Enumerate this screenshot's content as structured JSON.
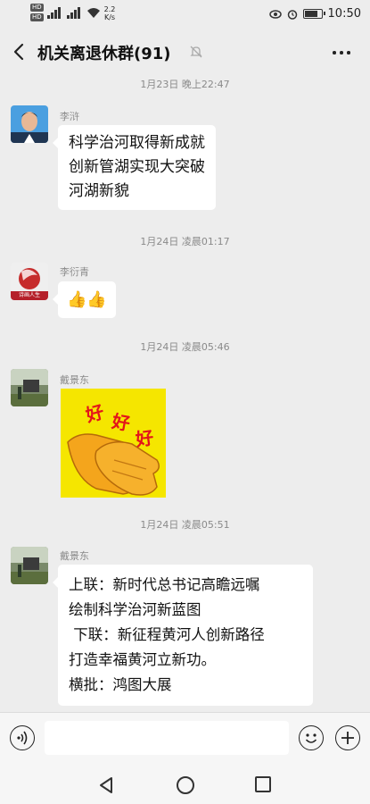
{
  "status_bar": {
    "sim1": "HD",
    "sim2": "HD",
    "network_speed_value": "2.2",
    "network_speed_unit": "K/s",
    "time": "10:50"
  },
  "header": {
    "title": "机关离退休群(91)"
  },
  "timestamps": [
    "1月23日 晚上22:47",
    "1月24日 凌晨01:17",
    "1月24日 凌晨05:46",
    "1月24日 凌晨05:51"
  ],
  "messages": [
    {
      "sender": "李浒",
      "lines": [
        "科学治河取得新成就",
        "创新管湖实现大突破",
        "河湖新貌"
      ]
    },
    {
      "sender": "李衍青",
      "content": "👍👍"
    },
    {
      "sender": "戴景东",
      "sticker_text": [
        "好",
        "好",
        "好"
      ]
    },
    {
      "sender": "戴景东",
      "lines": [
        "上联：新时代总书记高瞻远嘱",
        "绘制科学治河新蓝图",
        " 下联：新征程黄河人创新路径",
        "打造幸福黄河立新功。",
        "横批：鸿图大展"
      ]
    }
  ],
  "avatar_text": {
    "li_yanqing": "诗画人生"
  },
  "input_bar": {
    "placeholder": ""
  },
  "colors": {
    "chat_background": "#ededed",
    "bubble": "#ffffff",
    "sticker_background": "#f5e600",
    "sticker_text": "#e3151a"
  },
  "icons": [
    "back-icon",
    "mute-bell-icon",
    "more-icon",
    "voice-icon",
    "emoji-icon",
    "plus-icon",
    "nav-back-icon",
    "nav-home-icon",
    "nav-recent-icon"
  ]
}
